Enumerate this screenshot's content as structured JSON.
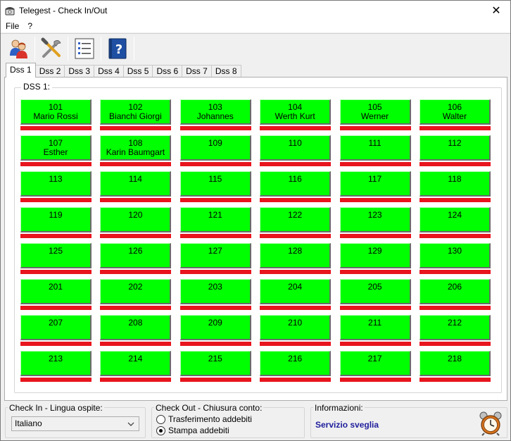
{
  "window": {
    "title": "Telegest - Check In/Out",
    "close_glyph": "✕"
  },
  "menu": {
    "items": [
      "File",
      "?"
    ]
  },
  "toolbar": {
    "buttons": [
      "guests-icon",
      "tools-icon",
      "list-icon",
      "help-book-icon"
    ]
  },
  "tabs": [
    "Dss 1",
    "Dss 2",
    "Dss 3",
    "Dss 4",
    "Dss 5",
    "Dss 6",
    "Dss 7",
    "Dss 8"
  ],
  "active_tab": 0,
  "group": {
    "label": "DSS 1:"
  },
  "colors": {
    "room_free": "#00ff00",
    "room_bar": "#e8141e",
    "info_text": "#1d1d9c"
  },
  "rooms": [
    {
      "number": "101",
      "guest": "Mario Rossi"
    },
    {
      "number": "102",
      "guest": "Bianchi Giorgi"
    },
    {
      "number": "103",
      "guest": "Johannes"
    },
    {
      "number": "104",
      "guest": "Werth Kurt"
    },
    {
      "number": "105",
      "guest": "Werner"
    },
    {
      "number": "106",
      "guest": "Walter"
    },
    {
      "number": "107",
      "guest": "Esther"
    },
    {
      "number": "108",
      "guest": "Karin Baumgart"
    },
    {
      "number": "109",
      "guest": ""
    },
    {
      "number": "110",
      "guest": ""
    },
    {
      "number": "111",
      "guest": ""
    },
    {
      "number": "112",
      "guest": ""
    },
    {
      "number": "113",
      "guest": ""
    },
    {
      "number": "114",
      "guest": ""
    },
    {
      "number": "115",
      "guest": ""
    },
    {
      "number": "116",
      "guest": ""
    },
    {
      "number": "117",
      "guest": ""
    },
    {
      "number": "118",
      "guest": ""
    },
    {
      "number": "119",
      "guest": ""
    },
    {
      "number": "120",
      "guest": ""
    },
    {
      "number": "121",
      "guest": ""
    },
    {
      "number": "122",
      "guest": ""
    },
    {
      "number": "123",
      "guest": ""
    },
    {
      "number": "124",
      "guest": ""
    },
    {
      "number": "125",
      "guest": ""
    },
    {
      "number": "126",
      "guest": ""
    },
    {
      "number": "127",
      "guest": ""
    },
    {
      "number": "128",
      "guest": ""
    },
    {
      "number": "129",
      "guest": ""
    },
    {
      "number": "130",
      "guest": ""
    },
    {
      "number": "201",
      "guest": ""
    },
    {
      "number": "202",
      "guest": ""
    },
    {
      "number": "203",
      "guest": ""
    },
    {
      "number": "204",
      "guest": ""
    },
    {
      "number": "205",
      "guest": ""
    },
    {
      "number": "206",
      "guest": ""
    },
    {
      "number": "207",
      "guest": ""
    },
    {
      "number": "208",
      "guest": ""
    },
    {
      "number": "209",
      "guest": ""
    },
    {
      "number": "210",
      "guest": ""
    },
    {
      "number": "211",
      "guest": ""
    },
    {
      "number": "212",
      "guest": ""
    },
    {
      "number": "213",
      "guest": ""
    },
    {
      "number": "214",
      "guest": ""
    },
    {
      "number": "215",
      "guest": ""
    },
    {
      "number": "216",
      "guest": ""
    },
    {
      "number": "217",
      "guest": ""
    },
    {
      "number": "218",
      "guest": ""
    }
  ],
  "checkin": {
    "label": "Check In - Lingua ospite:",
    "selected_language": "Italiano"
  },
  "checkout": {
    "label": "Check Out - Chiusura conto:",
    "options": [
      "Trasferimento addebiti",
      "Stampa addebiti"
    ],
    "selected_option": "Stampa addebiti"
  },
  "info": {
    "label": "Informazioni:",
    "text": "Servizio sveglia",
    "icon": "alarm-clock-icon"
  }
}
